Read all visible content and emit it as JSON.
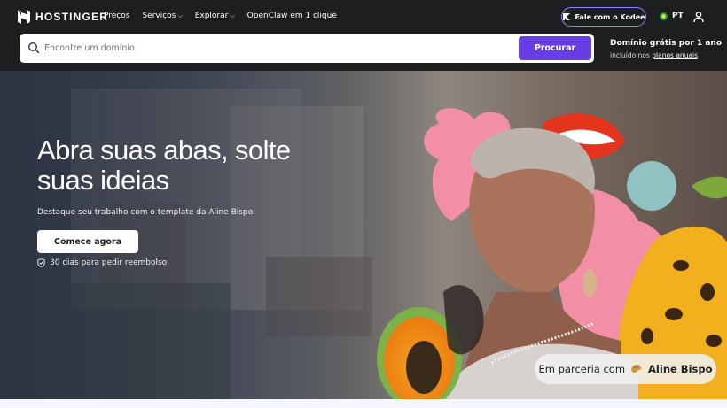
{
  "nav": {
    "logo_text": "HOSTINGER",
    "links": [
      {
        "label": "Preços",
        "has_dropdown": false
      },
      {
        "label": "Serviços",
        "has_dropdown": true
      },
      {
        "label": "Explorar",
        "has_dropdown": true
      },
      {
        "label": "OpenClaw em 1 clique",
        "has_dropdown": false
      }
    ],
    "kodee_label": "Fale com o Kodee",
    "language": "PT",
    "icons": {
      "kodee": "kodee-icon",
      "flag": "brazil-flag-icon",
      "user": "user-icon"
    }
  },
  "search": {
    "placeholder": "Encontre um domínio",
    "button_label": "Procurar",
    "promo_title": "Domínio grátis por 1 ano",
    "promo_prefix": "incluído nos",
    "promo_link": "planos anuais"
  },
  "hero": {
    "title_line1": "Abra suas abas, solte",
    "title_line2": "suas ideias",
    "subtitle": "Destaque seu trabalho com o template da Aline Bispo.",
    "cta_label": "Comece agora",
    "refund_text": "30 dias para pedir reembolso",
    "partner_prefix": "Em parceria com",
    "partner_name": "Aline Bispo"
  },
  "colors": {
    "nav_bg": "#1d1e20",
    "accent": "#673de6",
    "kodee_border": "#8c85ff"
  }
}
